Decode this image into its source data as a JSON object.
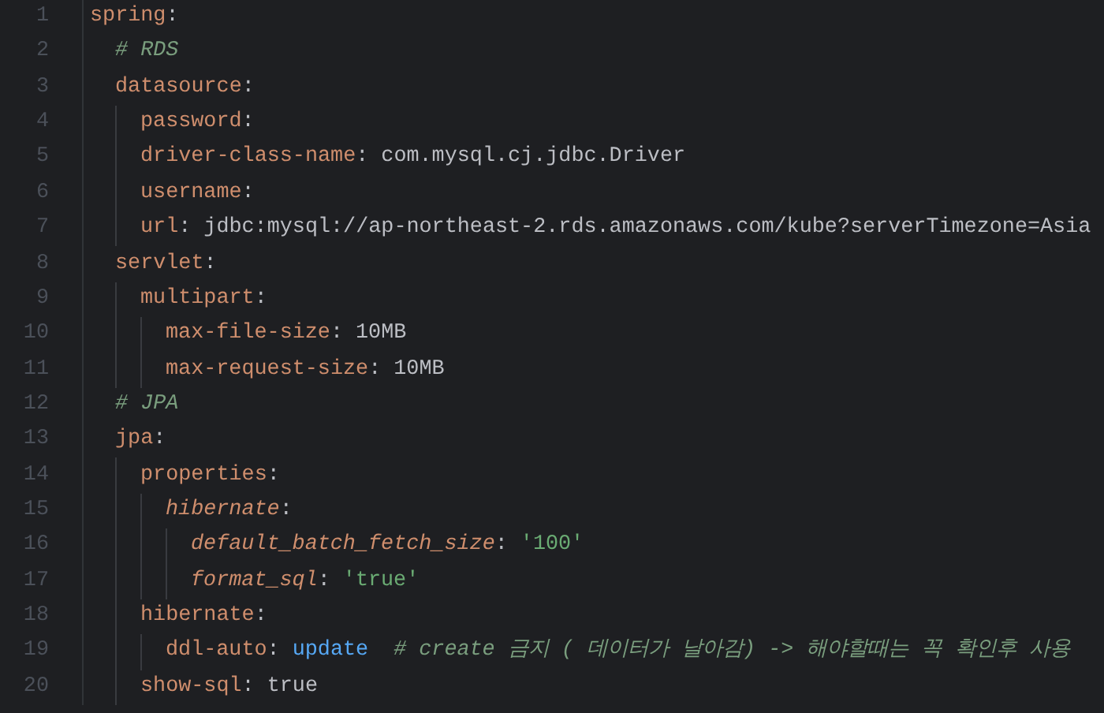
{
  "editor": {
    "lines": [
      {
        "number": "1",
        "tokens": [
          {
            "kind": "key",
            "text": "spring"
          },
          {
            "kind": "punct",
            "text": ":"
          }
        ],
        "children": [
          {
            "number": "2",
            "tokens": [
              {
                "kind": "comment",
                "text": "# RDS"
              }
            ]
          },
          {
            "number": "3",
            "tokens": [
              {
                "kind": "key",
                "text": "datasource"
              },
              {
                "kind": "punct",
                "text": ":"
              }
            ],
            "children": [
              {
                "number": "4",
                "tokens": [
                  {
                    "kind": "key",
                    "text": "password"
                  },
                  {
                    "kind": "punct",
                    "text": ":"
                  }
                ]
              },
              {
                "number": "5",
                "tokens": [
                  {
                    "kind": "key",
                    "text": "driver-class-name"
                  },
                  {
                    "kind": "punct",
                    "text": ":"
                  },
                  {
                    "kind": "value",
                    "text": "com.mysql.cj.jdbc.Driver"
                  }
                ]
              },
              {
                "number": "6",
                "tokens": [
                  {
                    "kind": "key",
                    "text": "username"
                  },
                  {
                    "kind": "punct",
                    "text": ":"
                  }
                ]
              },
              {
                "number": "7",
                "tokens": [
                  {
                    "kind": "key",
                    "text": "url"
                  },
                  {
                    "kind": "punct",
                    "text": ":"
                  },
                  {
                    "kind": "value",
                    "text": "jdbc:mysql://ap-northeast-2.rds.amazonaws.com/kube?serverTimezone=Asia"
                  }
                ]
              }
            ]
          },
          {
            "number": "8",
            "tokens": [
              {
                "kind": "key",
                "text": "servlet"
              },
              {
                "kind": "punct",
                "text": ":"
              }
            ],
            "children": [
              {
                "number": "9",
                "tokens": [
                  {
                    "kind": "key",
                    "text": "multipart"
                  },
                  {
                    "kind": "punct",
                    "text": ":"
                  }
                ],
                "children": [
                  {
                    "number": "10",
                    "tokens": [
                      {
                        "kind": "key",
                        "text": "max-file-size"
                      },
                      {
                        "kind": "punct",
                        "text": ":"
                      },
                      {
                        "kind": "value",
                        "text": "10MB"
                      }
                    ]
                  },
                  {
                    "number": "11",
                    "tokens": [
                      {
                        "kind": "key",
                        "text": "max-request-size"
                      },
                      {
                        "kind": "punct",
                        "text": ":"
                      },
                      {
                        "kind": "value",
                        "text": "10MB"
                      }
                    ]
                  }
                ]
              }
            ]
          },
          {
            "number": "12",
            "tokens": [
              {
                "kind": "comment",
                "text": "# JPA"
              }
            ]
          },
          {
            "number": "13",
            "tokens": [
              {
                "kind": "key",
                "text": "jpa"
              },
              {
                "kind": "punct",
                "text": ":"
              }
            ],
            "children": [
              {
                "number": "14",
                "tokens": [
                  {
                    "kind": "key",
                    "text": "properties"
                  },
                  {
                    "kind": "punct",
                    "text": ":"
                  }
                ],
                "children": [
                  {
                    "number": "15",
                    "tokens": [
                      {
                        "kind": "italic_key",
                        "text": "hibernate"
                      },
                      {
                        "kind": "punct",
                        "text": ":"
                      }
                    ],
                    "children": [
                      {
                        "number": "16",
                        "tokens": [
                          {
                            "kind": "italic_key",
                            "text": "default_batch_fetch_size"
                          },
                          {
                            "kind": "punct",
                            "text": ":"
                          },
                          {
                            "kind": "string",
                            "text": "'100'"
                          }
                        ]
                      },
                      {
                        "number": "17",
                        "tokens": [
                          {
                            "kind": "italic_key",
                            "text": "format_sql"
                          },
                          {
                            "kind": "punct",
                            "text": ":"
                          },
                          {
                            "kind": "string",
                            "text": "'true'"
                          }
                        ]
                      }
                    ]
                  }
                ]
              },
              {
                "number": "18",
                "tokens": [
                  {
                    "kind": "key",
                    "text": "hibernate"
                  },
                  {
                    "kind": "punct",
                    "text": ":"
                  }
                ],
                "children": [
                  {
                    "number": "19",
                    "tokens": [
                      {
                        "kind": "key",
                        "text": "ddl-auto"
                      },
                      {
                        "kind": "punct",
                        "text": ":"
                      },
                      {
                        "kind": "keyword",
                        "text": "update"
                      },
                      {
                        "kind": "comment",
                        "text": "# create 금지 ( 데이터가 날아감) -> 해야할때는 꼭 확인후 사용"
                      }
                    ]
                  }
                ]
              },
              {
                "number": "20",
                "tokens": [
                  {
                    "kind": "key",
                    "text": "show-sql"
                  },
                  {
                    "kind": "punct",
                    "text": ":"
                  },
                  {
                    "kind": "value",
                    "text": "true"
                  }
                ]
              }
            ]
          }
        ]
      }
    ]
  }
}
